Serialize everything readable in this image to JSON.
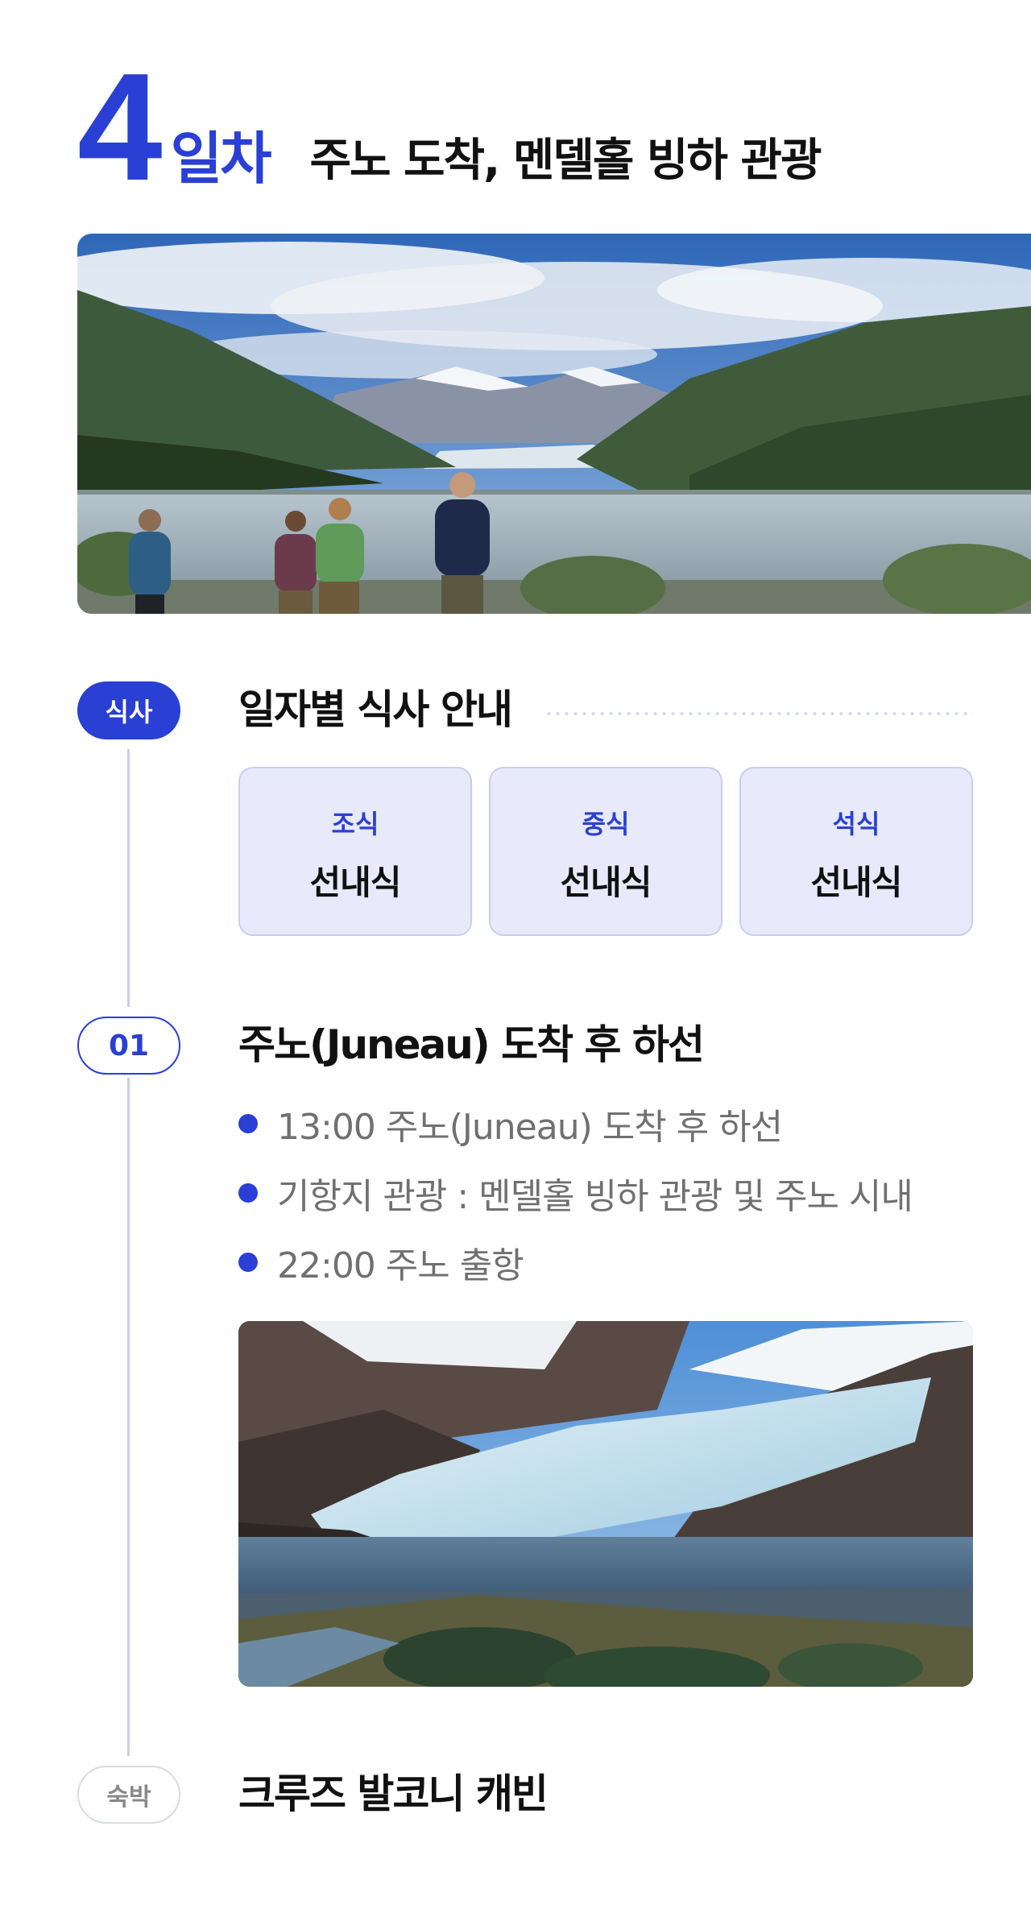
{
  "header": {
    "day_number": "4",
    "day_label": "일차",
    "title": "주노 도착, 멘델홀 빙하 관광"
  },
  "hero_image": {
    "description_icon": "mendenhall-lake-photo"
  },
  "meals": {
    "badge": "식사",
    "title": "일자별 식사 안내",
    "items": [
      {
        "type": "조식",
        "value": "선내식"
      },
      {
        "type": "중식",
        "value": "선내식"
      },
      {
        "type": "석식",
        "value": "선내식"
      }
    ]
  },
  "step": {
    "badge": "01",
    "title": "주노(Juneau) 도착 후 하선",
    "bullets": [
      "13:00 주노(Juneau) 도착 후 하선",
      "기항지 관광 : 멘델홀 빙하 관광 및 주노 시내",
      "22:00 주노 출항"
    ]
  },
  "glacier_image": {
    "description_icon": "mendenhall-glacier-photo"
  },
  "lodging": {
    "badge": "숙박",
    "title": "크루즈 발코니 캐빈"
  },
  "colors": {
    "accent": "#2a3fd4",
    "card_bg": "#e8eafb",
    "line": "#c9cfe2"
  }
}
